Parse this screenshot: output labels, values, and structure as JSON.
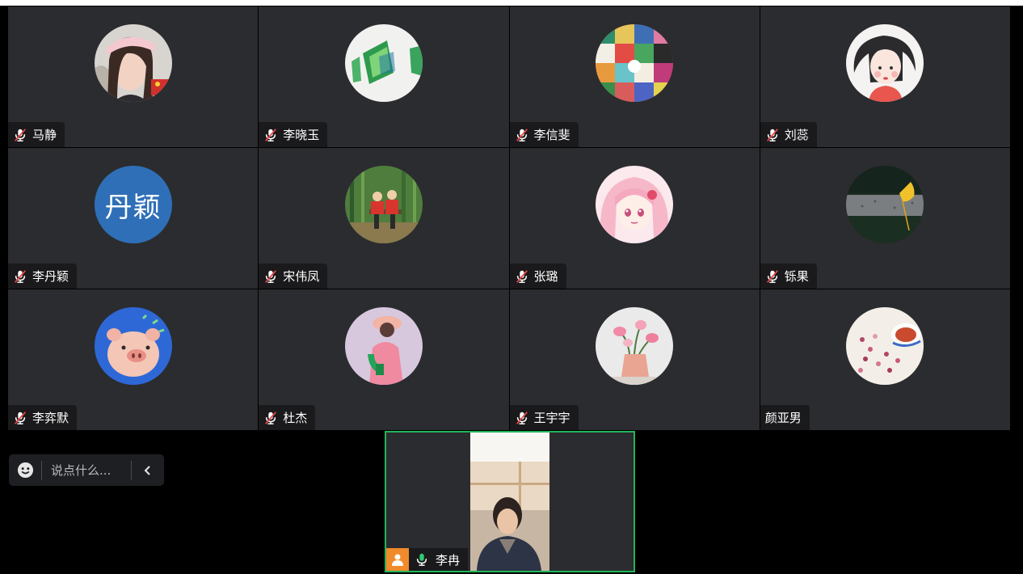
{
  "participants": [
    {
      "name": "马静",
      "mic": "off",
      "avatar": "photo-woman-selfie"
    },
    {
      "name": "李晓玉",
      "mic": "off",
      "avatar": "photo-green-paper"
    },
    {
      "name": "李信斐",
      "mic": "off",
      "avatar": "photo-colorful-collage"
    },
    {
      "name": "刘蕊",
      "mic": "off",
      "avatar": "illustration-girl"
    },
    {
      "name": "李丹颖",
      "mic": "off",
      "avatar": "initials",
      "initials": "丹颖",
      "color": "#2f6fb7"
    },
    {
      "name": "宋伟凤",
      "mic": "off",
      "avatar": "photo-people-bamboo"
    },
    {
      "name": "张璐",
      "mic": "off",
      "avatar": "anime-pink-girl"
    },
    {
      "name": "铄果",
      "mic": "off",
      "avatar": "photo-ginkgo-leaf"
    },
    {
      "name": "李弈默",
      "mic": "off",
      "avatar": "cartoon-pig"
    },
    {
      "name": "杜杰",
      "mic": "off",
      "avatar": "illustration-pink-figure"
    },
    {
      "name": "王宇宇",
      "mic": "off",
      "avatar": "photo-pink-flowers"
    },
    {
      "name": "颜亚男",
      "mic": "none",
      "avatar": "photo-flower-tea"
    }
  ],
  "chat": {
    "placeholder": "说点什么..."
  },
  "self": {
    "name": "李冉",
    "mic": "on",
    "border_color": "#23b45b",
    "host_badge_color": "#f08a2a"
  },
  "colors": {
    "tile_bg": "#2b2c2f",
    "nametag_bg": "#1a1a1c",
    "background": "#000000"
  }
}
